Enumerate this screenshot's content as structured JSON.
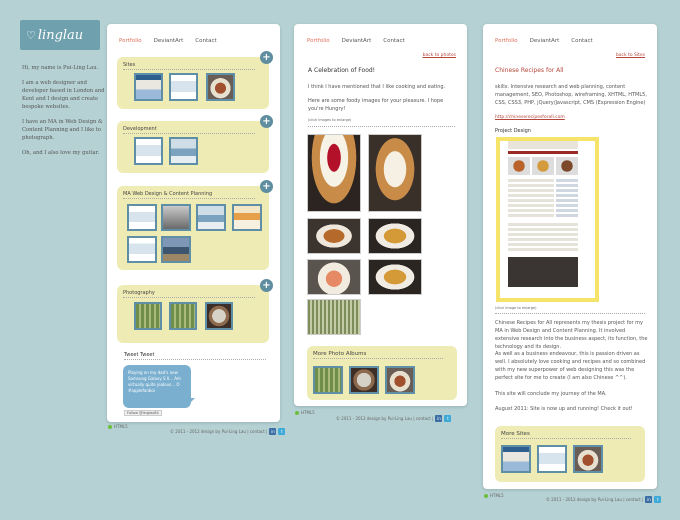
{
  "logo": {
    "text": "linglau",
    "icon": "heart-icon"
  },
  "intro": {
    "p1": "Hi, my name is Pui-Ling Lau.",
    "p2": "I am a web designer and developer based in London and Kent and I design and create bespoke websites.",
    "p3": "I have an MA in Web Design & Content Planning and I like to photograph.",
    "p4": "Oh, and I also love my guitar."
  },
  "nav": {
    "portfolio": "Portfolio",
    "deviantart": "DeviantArt",
    "contact": "Contact"
  },
  "col1": {
    "sections": {
      "sites": "Sites",
      "development": "Development",
      "ma": "MA Web Design & Content Planning",
      "photography": "Photography"
    },
    "tweet": {
      "title": "Tweet Tweet",
      "text": "Playing on my dad's new Samsung Galaxy S II... Am virtually quite jealous... O #applefanboi",
      "follow": "Follow @linglau84"
    }
  },
  "col2": {
    "back": "back to photos",
    "title": "A Celebration of Food!",
    "p1": "I think I have mentioned that I like cooking and eating.",
    "p2": "Here are some foody images for your pleasure. I hope you're Hungry!",
    "hint": "(click images to enlarge)",
    "more": "More Photo Albums"
  },
  "col3": {
    "back": "back to Sites",
    "title": "Chinese Recipes for All",
    "skills": "skills: Intensive research and web planning, content management, SEO, Photoshop, wireframing, XHTML, HTML5, CSS, CSS3, PHP, jQuery/Javascript, CMS (Expression Engine)",
    "url": "http://chineserecipesforall.com",
    "project_design": "Project Design",
    "hint": "(click image to enlarge)",
    "p1": "Chinese Recipes for All represents my thesis project for my MA in Web Design and Content Planning. It involved extensive research into the business aspect, its function, the technology and its design.",
    "p2": "As well as a business endeavour, this is passion driven as well. I absolutely love cooking and recipes and so combined with my new superpower of web designing this was the perfect site for me to create (I am also Chinese ^^).",
    "p3": "This site will conclude my journey of the MA.",
    "p4": "August 2011: Site is now up and running! Check it out!",
    "more": "More Sites"
  },
  "footer": {
    "html5": "HTML5",
    "copyright": "© 2011 - 2012 design by Pui-Ling Lau | contact |"
  }
}
